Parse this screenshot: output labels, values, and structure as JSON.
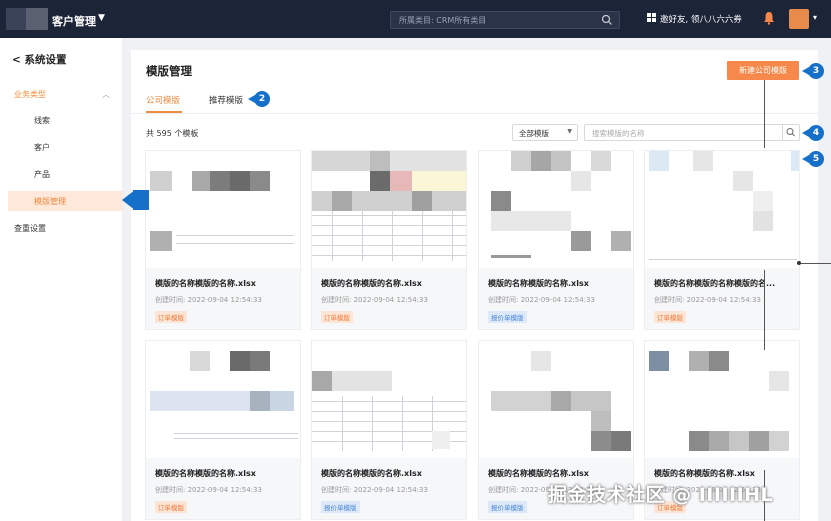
{
  "header": {
    "app_title": "客户管理",
    "search_placeholder": "所属类目: CRM所有类目",
    "invite_text": "邀好友, 领八八六六券"
  },
  "sidebar": {
    "back_label": "系统设置",
    "group_label": "业务类型",
    "items": [
      {
        "label": "线索"
      },
      {
        "label": "客户"
      },
      {
        "label": "产品"
      },
      {
        "label": "模版管理",
        "active": true
      }
    ],
    "bottom_label": "查重设置"
  },
  "main": {
    "title": "模版管理",
    "new_button": "新建公司模版",
    "tabs": [
      {
        "label": "公司模版",
        "active": true
      },
      {
        "label": "推荐模版",
        "active": false
      }
    ],
    "total_text": "共 595 个模板",
    "filter_value": "全部模版",
    "search_placeholder": "搜索模版的名称",
    "cards": [
      {
        "name": "模版的名称模版的名称.xlsx",
        "time": "创建时间: 2022-09-04 12:54:33",
        "tag": "订单模版"
      },
      {
        "name": "模版的名称模版的名称.xlsx",
        "time": "创建时间: 2022-09-04 12:54:33",
        "tag": "订单模版"
      },
      {
        "name": "模版的名称模版的名称.xlsx",
        "time": "创建时间: 2022-09-04 12:54:33",
        "tag": "报价单模版"
      },
      {
        "name": "模版的名称模版的名称模版的名...",
        "time": "创建时间: 2022-09-04 12:54:33",
        "tag": "订单模版"
      },
      {
        "name": "模版的名称模版的名称.xlsx",
        "time": "创建时间: 2022-09-04 12:54:33",
        "tag": "订单模版"
      },
      {
        "name": "模版的名称模版的名称.xlsx",
        "time": "创建时间: 2022-09-04 12:54:33",
        "tag": "报价单模版"
      },
      {
        "name": "模版的名称模版的名称.xlsx",
        "time": "创建时间: 2022-09-04 12:54:33",
        "tag": "报价单模版"
      },
      {
        "name": "模版的名称模版的名称.xlsx",
        "time": "创建时间: 2022-09-04 12:54:33",
        "tag": "订单模版"
      }
    ]
  },
  "annotations": [
    "2",
    "3",
    "4",
    "5"
  ],
  "watermark": "掘金技术社区 @ IIIIIIHL",
  "colors": {
    "topbar": "#1c2438",
    "accent": "#f08a3e",
    "button": "#f5884a",
    "annotation": "#1670c9"
  }
}
